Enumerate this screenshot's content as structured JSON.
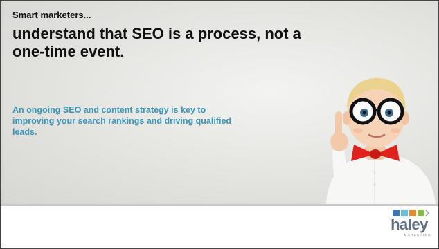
{
  "slide": {
    "kicker": "Smart marketers...",
    "headline": "understand that SEO is a process, not a one-time event.",
    "body": "An ongoing SEO and content strategy is key to improving your search rankings and driving qualified leads."
  },
  "logo": {
    "name": "haley",
    "tagline": "MARKETING"
  },
  "colors": {
    "accent_text": "#3a95b8",
    "logo_name": "#5f6d86",
    "background": "#e6e6e3"
  }
}
